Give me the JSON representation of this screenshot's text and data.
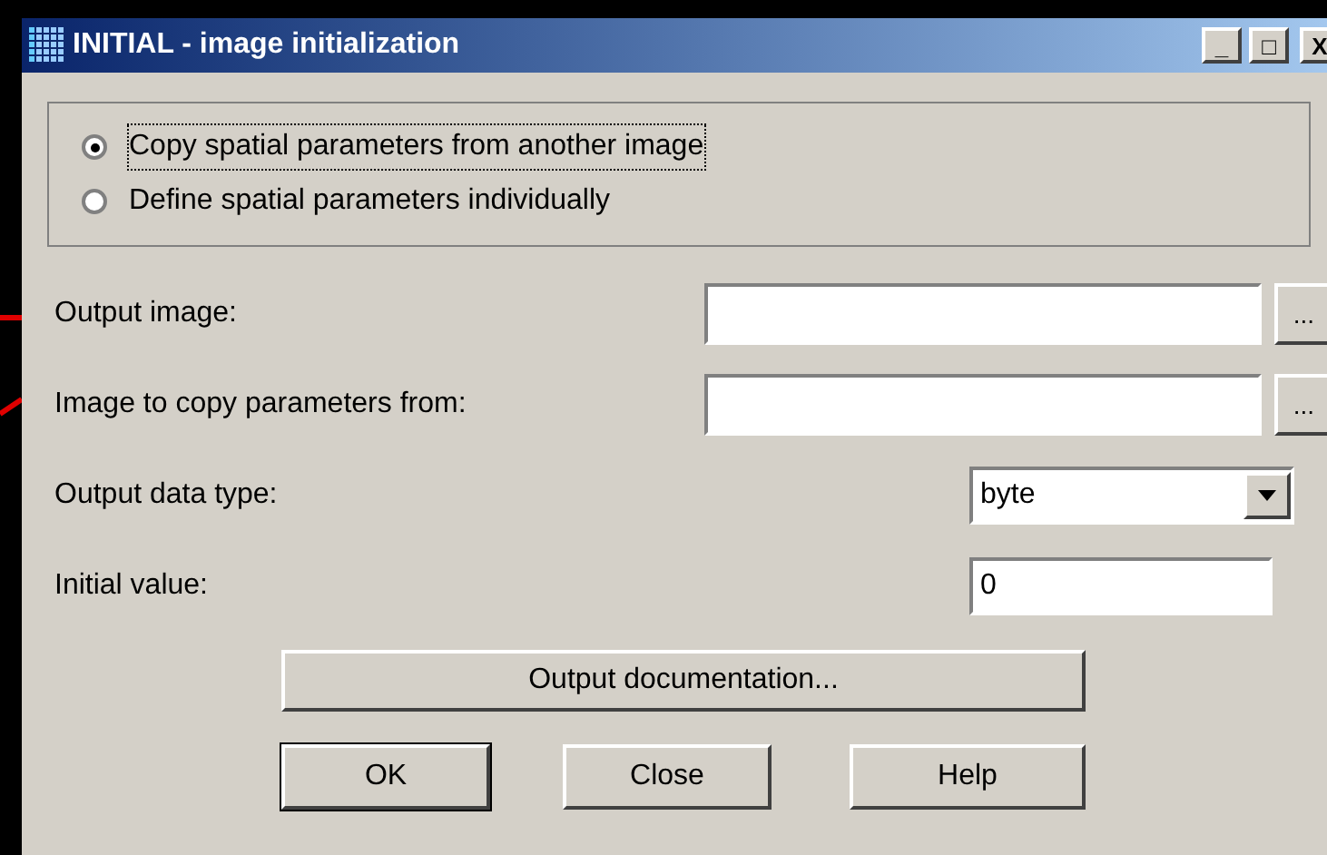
{
  "window": {
    "title": "INITIAL - image initialization",
    "controls": [
      "_",
      "□",
      "X"
    ]
  },
  "options": [
    {
      "label": "Copy spatial parameters from another image",
      "selected": true
    },
    {
      "label": "Define spatial parameters individually",
      "selected": false
    }
  ],
  "fields": [
    {
      "kind": "file",
      "label": "Output image:",
      "browse": "..."
    },
    {
      "kind": "file",
      "label": "Image to copy parameters from:",
      "browse": "..."
    },
    {
      "kind": "select",
      "label": "Output data type:",
      "value": "byte"
    },
    {
      "kind": "text",
      "label": "Initial value:",
      "value": "0"
    }
  ],
  "doc_button": "Output documentation...",
  "buttons": [
    "OK",
    "Close",
    "Help"
  ]
}
